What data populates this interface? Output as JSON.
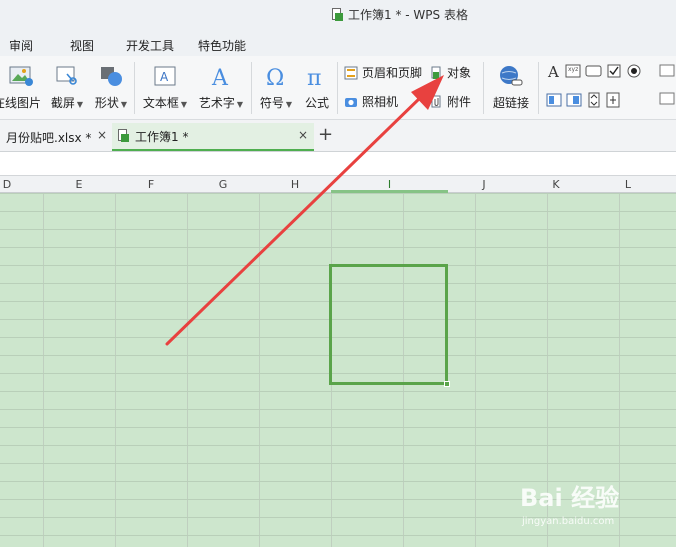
{
  "window": {
    "title": "工作簿1 * - WPS 表格"
  },
  "menu": {
    "items": [
      "审阅",
      "视图",
      "开发工具",
      "特色功能"
    ]
  },
  "ribbon": {
    "online_picture": "在线图片",
    "screenshot": "截屏",
    "shape": "形状",
    "textbox": "文本框",
    "wordart": "艺术字",
    "symbol": "符号",
    "formula": "公式",
    "header_footer": "页眉和页脚",
    "object": "对象",
    "camera": "照相机",
    "attachment": "附件",
    "hyperlink": "超链接"
  },
  "tabs": [
    {
      "label": "月份贴吧.xlsx *"
    },
    {
      "label": "工作簿1 *"
    }
  ],
  "new_tab": "+",
  "close_glyph": "×",
  "columns": [
    "D",
    "E",
    "F",
    "G",
    "H",
    "I",
    "J",
    "K",
    "L"
  ],
  "selected_column": "I",
  "watermark": {
    "logo": "Bai 经验",
    "url": "jingyan.baidu.com"
  },
  "colors": {
    "accent": "#4fae4f",
    "arrow": "#e8413f",
    "grid_bg": "#cde6cd"
  }
}
